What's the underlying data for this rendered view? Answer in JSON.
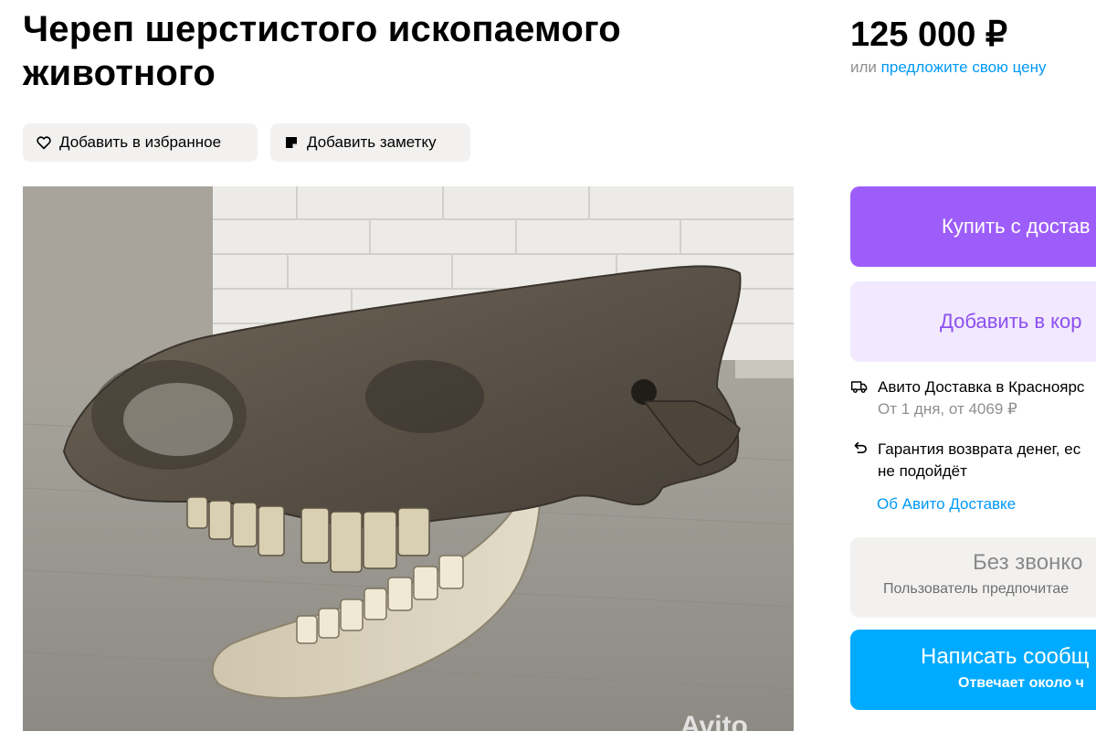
{
  "listing": {
    "title": "Череп шерстистого ископаемого животного",
    "price": "125 000 ₽",
    "offer_prefix": "или",
    "offer_link": "предложите свою цену"
  },
  "actions": {
    "favorite_label": "Добавить в избранное",
    "note_label": "Добавить заметку"
  },
  "photo": {
    "watermark": "Avito"
  },
  "buy": {
    "buy_delivery_label": "Купить с достав",
    "add_to_cart_label": "Добавить в кор"
  },
  "delivery": {
    "title": "Авито Доставка в Красноярс",
    "details": "От 1 дня, от 4069 ₽",
    "guarantee_line1": "Гарантия возврата денег, ес",
    "guarantee_line2": "не подойдёт",
    "about_link": "Об Авито Доставке"
  },
  "contact": {
    "no_calls_title": "Без звонко",
    "no_calls_sub": "Пользователь предпочитае",
    "message_title": "Написать сообщ",
    "message_sub": "Отвечает около ч"
  },
  "icons": [
    "heart-icon",
    "note-icon",
    "truck-icon",
    "return-icon"
  ],
  "colors": {
    "buy_button": "#9d5dfa",
    "cart_button_bg": "#f2e9ff",
    "cart_button_text": "#8c4ff0",
    "link": "#0099f7",
    "message_button": "#00aaff",
    "chip_bg": "#f2f1f0"
  }
}
